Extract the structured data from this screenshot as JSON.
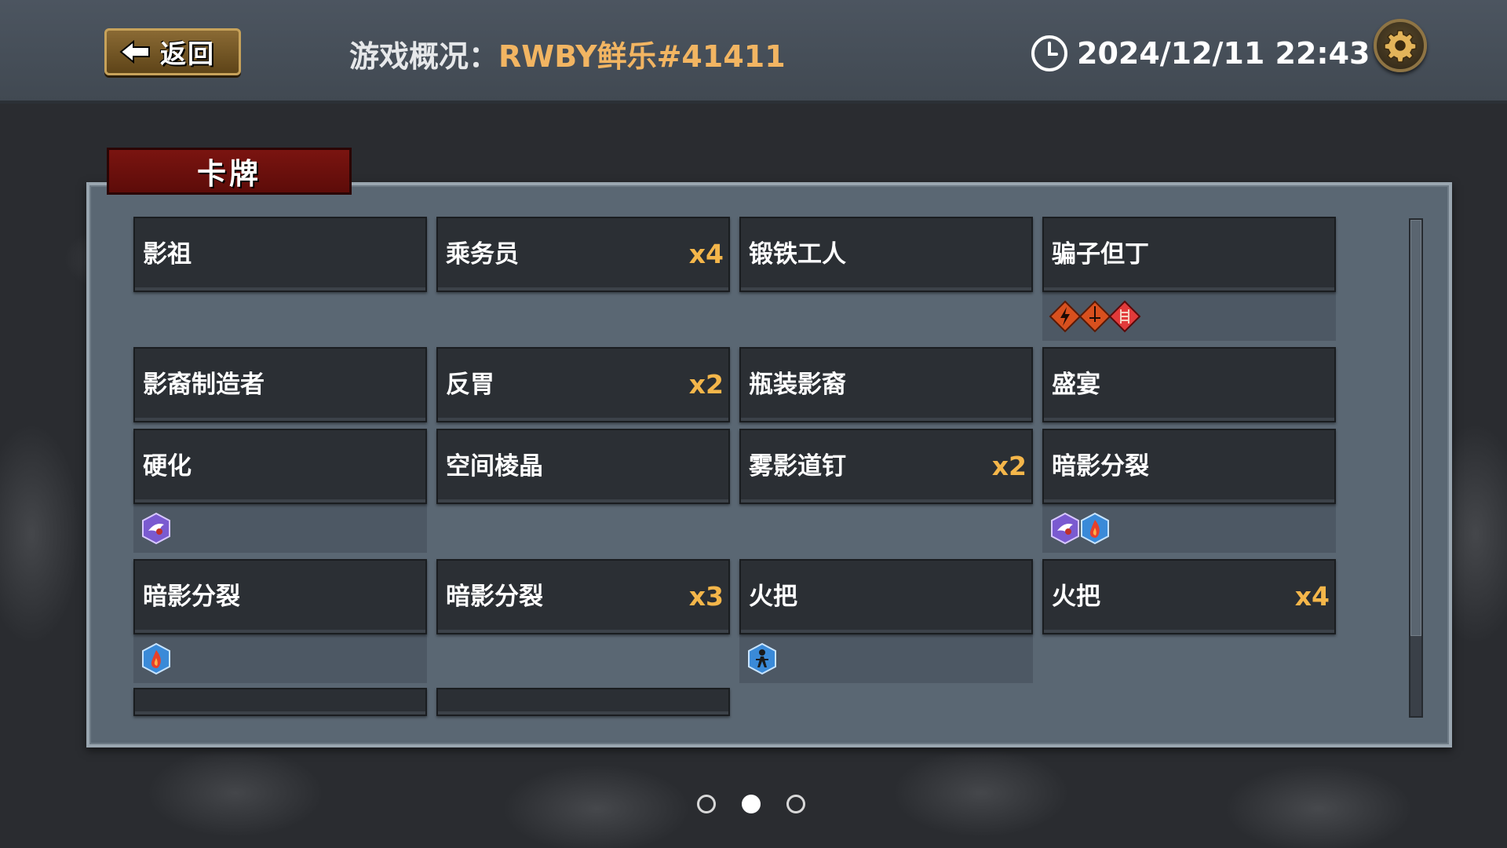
{
  "topbar": {
    "back_label": "返回",
    "title_label": "游戏概况：",
    "game_name": "RWBY鲜乐#41411",
    "datetime": "2024/12/11 22:43",
    "settings_icon": "gear-icon",
    "clock_icon": "clock-icon"
  },
  "section": {
    "tab_label": "卡牌"
  },
  "cards": [
    {
      "name": "影祖",
      "count": ""
    },
    {
      "name": "乘务员",
      "count": "x4"
    },
    {
      "name": "锻铁工人",
      "count": ""
    },
    {
      "name": "骗子但丁",
      "count": "",
      "badges": [
        "lightning-rune-icon",
        "sword-rune-icon",
        "ladder-rune-icon"
      ]
    },
    {
      "name": "影裔制造者",
      "count": ""
    },
    {
      "name": "反胃",
      "count": "x2"
    },
    {
      "name": "瓶装影裔",
      "count": ""
    },
    {
      "name": "盛宴",
      "count": ""
    },
    {
      "name": "硬化",
      "count": "",
      "badges": [
        "purple-bird-hex-icon"
      ]
    },
    {
      "name": "空间棱晶",
      "count": ""
    },
    {
      "name": "雾影道钉",
      "count": "x2"
    },
    {
      "name": "暗影分裂",
      "count": "",
      "badges": [
        "purple-bird-hex-icon",
        "blue-flame-hex-icon"
      ]
    },
    {
      "name": "暗影分裂",
      "count": "",
      "badges": [
        "blue-flame-hex-icon"
      ]
    },
    {
      "name": "暗影分裂",
      "count": "x3"
    },
    {
      "name": "火把",
      "count": "",
      "badges": [
        "blue-figure-hex-icon"
      ]
    },
    {
      "name": "火把",
      "count": "x4"
    },
    {
      "name": "",
      "count": ""
    },
    {
      "name": "",
      "count": ""
    }
  ],
  "pager": {
    "pages": 3,
    "active_index": 1
  },
  "colors": {
    "accent_gold": "#f2b562",
    "count_gold": "#f4b64a",
    "tab_red": "#7a1410"
  }
}
